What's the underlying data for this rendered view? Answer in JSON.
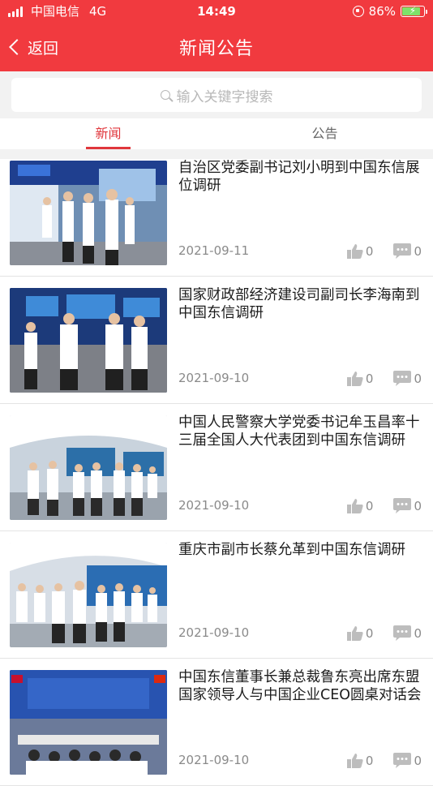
{
  "status_bar": {
    "carrier": "中国电信",
    "network": "4G",
    "time": "14:49",
    "battery": "86%",
    "battery_level": 0.86
  },
  "nav": {
    "back_label": "返回",
    "title": "新闻公告"
  },
  "search": {
    "placeholder": "输入关键字搜索"
  },
  "tabs": [
    {
      "label": "新闻",
      "active": true
    },
    {
      "label": "公告",
      "active": false
    }
  ],
  "news": [
    {
      "title": "自治区党委副书记刘小明到中国东信展位调研",
      "date": "2021-09-11",
      "likes": "0",
      "comments": "0"
    },
    {
      "title": "国家财政部经济建设司副司长李海南到中国东信调研",
      "date": "2021-09-10",
      "likes": "0",
      "comments": "0"
    },
    {
      "title": "中国人民警察大学党委书记牟玉昌率十三届全国人大代表团到中国东信调研",
      "date": "2021-09-10",
      "likes": "0",
      "comments": "0"
    },
    {
      "title": "重庆市副市长蔡允革到中国东信调研",
      "date": "2021-09-10",
      "likes": "0",
      "comments": "0"
    },
    {
      "title": "中国东信董事长兼总裁鲁东亮出席东盟国家领导人与中国企业CEO圆桌对话会",
      "date": "2021-09-10",
      "likes": "0",
      "comments": "0"
    }
  ],
  "colors": {
    "brand_red": "#f13a3f",
    "tab_active": "#e0373c"
  },
  "icons": {
    "like": "thumbs-up-icon",
    "comment": "comment-bubble-icon",
    "back": "chevron-left-icon",
    "search": "search-icon"
  }
}
